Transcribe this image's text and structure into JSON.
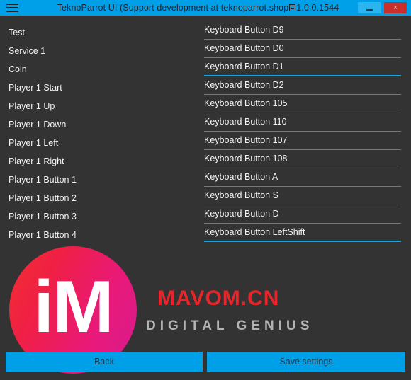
{
  "window": {
    "title_prefix": "TeknoParrot UI (Support development at teknoparrot.shop",
    "title_suffix": "1.0.0.1544",
    "menu_icon": "hamburger-icon",
    "minimize_label": "",
    "close_label": "×"
  },
  "bindings": {
    "rows": [
      {
        "label": "Test",
        "value": "Keyboard Button D9",
        "active": false
      },
      {
        "label": "Service 1",
        "value": "Keyboard Button D0",
        "active": false
      },
      {
        "label": "Coin",
        "value": "Keyboard Button D1",
        "active": true
      },
      {
        "label": "Player 1 Start",
        "value": "Keyboard Button D2",
        "active": false
      },
      {
        "label": "Player 1 Up",
        "value": "Keyboard Button 105",
        "active": false
      },
      {
        "label": "Player 1 Down",
        "value": "Keyboard Button 110",
        "active": false
      },
      {
        "label": "Player 1 Left",
        "value": "Keyboard Button 107",
        "active": false
      },
      {
        "label": "Player 1 Right",
        "value": "Keyboard Button 108",
        "active": false
      },
      {
        "label": "Player 1 Button 1",
        "value": "Keyboard Button A",
        "active": false
      },
      {
        "label": "Player 1 Button 2",
        "value": "Keyboard Button S",
        "active": false
      },
      {
        "label": "Player 1 Button 3",
        "value": "Keyboard Button D",
        "active": false
      },
      {
        "label": "Player 1 Button 4",
        "value": "Keyboard Button LeftShift",
        "active": true
      }
    ]
  },
  "footer": {
    "back_label": "Back",
    "save_label": "Save settings"
  },
  "watermark": {
    "logo_text": "iM",
    "brand": "MAVOM.CN",
    "tagline": "DIGITAL GENIUS"
  },
  "colors": {
    "accent_blue": "#00a0e9",
    "focus_blue": "#12a5e8",
    "background": "#333333",
    "close_red": "#c9302c",
    "brand_red": "#e8252b"
  }
}
